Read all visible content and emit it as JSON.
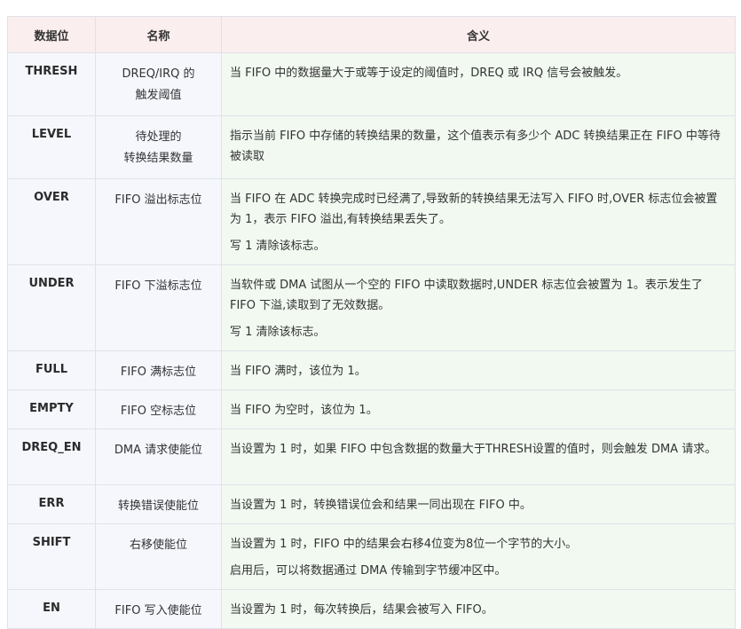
{
  "headers": [
    "数据位",
    "名称",
    "含义"
  ],
  "rows": [
    {
      "bit": "THRESH",
      "name_lines": [
        "DREQ/IRQ 的",
        "触发阈值"
      ],
      "desc": [
        "当 FIFO 中的数据量大于或等于设定的阈值时，DREQ 或 IRQ 信号会被触发。"
      ]
    },
    {
      "bit": "LEVEL",
      "name_lines": [
        "待处理的",
        "转换结果数量"
      ],
      "desc": [
        "指示当前 FIFO 中存储的转换结果的数量，这个值表示有多少个 ADC 转换结果正在 FIFO 中等待被读取"
      ]
    },
    {
      "bit": "OVER",
      "name_lines": [
        "FIFO 溢出标志位"
      ],
      "desc": [
        "当 FIFO 在 ADC 转换完成时已经满了,导致新的转换结果无法写入 FIFO 时,OVER 标志位会被置为 1，表示 FIFO 溢出,有转换结果丢失了。",
        "写 1 清除该标志。"
      ]
    },
    {
      "bit": "UNDER",
      "name_lines": [
        "FIFO 下溢标志位"
      ],
      "desc": [
        "当软件或 DMA 试图从一个空的 FIFO 中读取数据时,UNDER 标志位会被置为 1。表示发生了 FIFO 下溢,读取到了无效数据。",
        "写 1 清除该标志。"
      ]
    },
    {
      "bit": "FULL",
      "name_lines": [
        "FIFO 满标志位"
      ],
      "desc": [
        "当 FIFO 满时，该位为 1。"
      ]
    },
    {
      "bit": "EMPTY",
      "name_lines": [
        "FIFO 空标志位"
      ],
      "desc": [
        "当 FIFO 为空时，该位为 1。"
      ]
    },
    {
      "bit": "DREQ_EN",
      "name_lines": [
        "DMA 请求使能位"
      ],
      "desc": [
        "当设置为 1 时，如果 FIFO 中包含数据的数量大于THRESH设置的值时，则会触发 DMA 请求。"
      ]
    },
    {
      "bit": "ERR",
      "name_lines": [
        "转换错误使能位"
      ],
      "desc": [
        "当设置为 1 时，转换错误位会和结果一同出现在 FIFO 中。"
      ]
    },
    {
      "bit": "SHIFT",
      "name_lines": [
        "右移使能位"
      ],
      "desc": [
        "当设置为 1 时，FIFO 中的结果会右移4位变为8位一个字节的大小。",
        "启用后，可以将数据通过 DMA 传输到字节缓冲区中。"
      ]
    },
    {
      "bit": "EN",
      "name_lines": [
        "FIFO 写入使能位"
      ],
      "desc": [
        "当设置为 1 时，每次转换后，结果会被写入 FIFO。"
      ]
    }
  ]
}
